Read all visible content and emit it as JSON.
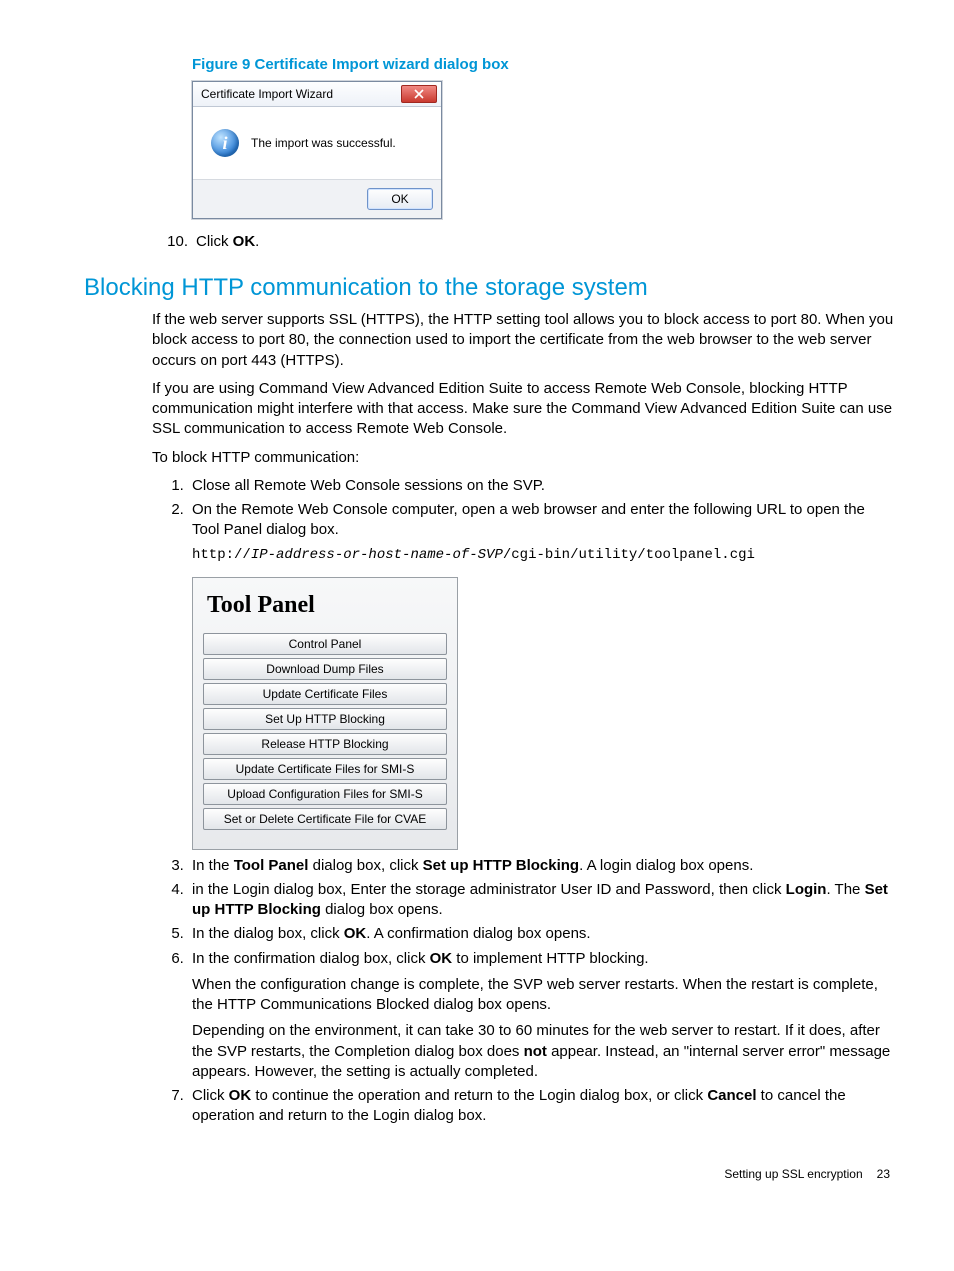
{
  "figure": {
    "caption": "Figure 9 Certificate Import wizard dialog box",
    "dialog": {
      "title": "Certificate Import Wizard",
      "message": "The import was successful.",
      "ok_label": "OK"
    }
  },
  "step10": {
    "num": "10.",
    "text_pre": "Click ",
    "bold": "OK",
    "text_post": "."
  },
  "heading": "Blocking HTTP communication to the storage system",
  "para1": "If the web server supports SSL (HTTPS), the HTTP setting tool allows you to block access to port 80. When you block access to port 80, the connection used to import the certificate from the web browser to the web server occurs on port 443 (HTTPS).",
  "para2": "If you are using Command View Advanced Edition Suite to access Remote Web Console, blocking HTTP communication might interfere with that access. Make sure the Command View Advanced Edition Suite can use SSL communication to access Remote Web Console.",
  "para3": "To block HTTP communication:",
  "steps": {
    "s1": "Close all Remote Web Console sessions on the SVP.",
    "s2": "On the Remote Web Console computer, open a web browser and enter the following URL to open the Tool Panel dialog box.",
    "url": {
      "pre": "http://",
      "var": "IP-address-or-host-name-of-SVP",
      "post": "/cgi-bin/utility/toolpanel.cgi"
    },
    "s3": {
      "a": "In the ",
      "b": "Tool Panel",
      "c": " dialog box, click ",
      "d": "Set up HTTP Blocking",
      "e": ". A login dialog box opens."
    },
    "s4": {
      "a": "in the Login dialog box, Enter the storage administrator User ID and Password, then click ",
      "b": "Login",
      "c": ". The ",
      "d": "Set up HTTP Blocking",
      "e": " dialog box opens."
    },
    "s5": {
      "a": "In the dialog box, click ",
      "b": "OK",
      "c": ". A confirmation dialog box opens."
    },
    "s6": {
      "a": "In the confirmation dialog box, click ",
      "b": "OK",
      "c": " to implement HTTP blocking."
    },
    "s6_sub1": "When the configuration change is complete, the SVP web server restarts. When the restart is complete, the HTTP Communications Blocked dialog box opens.",
    "s6_sub2": {
      "a": "Depending on the environment, it can take 30 to 60 minutes for the web server to restart. If it does, after the SVP restarts, the Completion dialog box does ",
      "b": "not",
      "c": " appear. Instead, an \"internal server error\" message appears. However, the setting is actually completed."
    },
    "s7": {
      "a": "Click ",
      "b": "OK",
      "c": " to continue the operation and return to the Login dialog box, or click ",
      "d": "Cancel",
      "e": " to cancel the operation and return to the Login dialog box."
    }
  },
  "tool_panel": {
    "title": "Tool Panel",
    "buttons": [
      "Control Panel",
      "Download Dump Files",
      "Update Certificate Files",
      "Set Up HTTP Blocking",
      "Release HTTP Blocking",
      "Update Certificate Files for SMI-S",
      "Upload Configuration Files for SMI-S",
      "Set or Delete Certificate File for CVAE"
    ]
  },
  "footer": {
    "section": "Setting up SSL encryption",
    "page": "23"
  }
}
